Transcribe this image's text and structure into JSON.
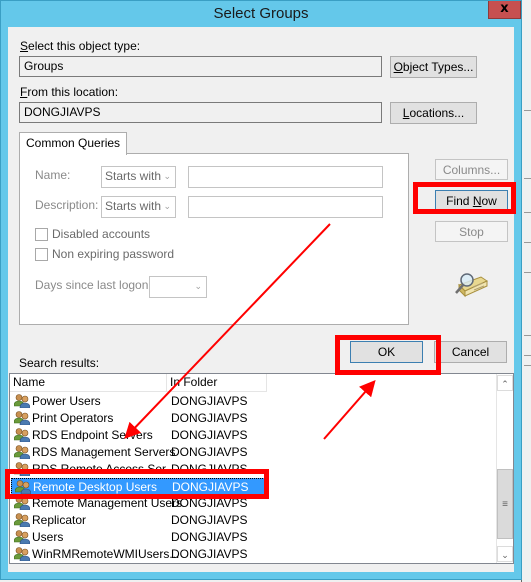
{
  "window": {
    "title": "Select Groups",
    "close_label": "x"
  },
  "object_type": {
    "label_prefix": "S",
    "label_rest": "elect this object type:",
    "value": "Groups",
    "button_prefix": "O",
    "button_rest": "bject Types..."
  },
  "location": {
    "label_prefix": "F",
    "label_rest": "rom this location:",
    "value": "DONGJIAVPS",
    "button_prefix": "L",
    "button_rest": "ocations..."
  },
  "query_tab": {
    "label": "Common Queries",
    "name_label": "Name:",
    "name_operator": "Starts with",
    "name_value": "",
    "description_label": "Description:",
    "description_operator": "Starts with",
    "description_value": "",
    "disabled_accounts_label": "Disabled accounts",
    "disabled_accounts_checked": false,
    "non_expiring_label": "Non expiring password",
    "non_expiring_checked": false,
    "days_label": "Days since last logon:",
    "days_value": ""
  },
  "side_buttons": {
    "columns": "Columns...",
    "find_now_prefix": "Find ",
    "find_now_u": "N",
    "find_now_rest": "ow",
    "stop": "Stop",
    "search_icon": "magnifier-over-directory-icon"
  },
  "dialog_buttons": {
    "ok": "OK",
    "cancel": "Cancel"
  },
  "results": {
    "label": "Search results:",
    "columns": [
      "Name",
      "In Folder"
    ],
    "rows": [
      {
        "name": "Power Users",
        "folder": "DONGJIAVPS",
        "selected": false
      },
      {
        "name": "Print Operators",
        "folder": "DONGJIAVPS",
        "selected": false
      },
      {
        "name": "RDS Endpoint Servers",
        "folder": "DONGJIAVPS",
        "selected": false
      },
      {
        "name": "RDS Management Servers",
        "folder": "DONGJIAVPS",
        "selected": false
      },
      {
        "name": "RDS Remote Access Ser...",
        "folder": "DONGJIAVPS",
        "selected": false
      },
      {
        "name": "Remote Desktop Users",
        "folder": "DONGJIAVPS",
        "selected": true
      },
      {
        "name": "Remote Management Users",
        "folder": "DONGJIAVPS",
        "selected": false
      },
      {
        "name": "Replicator",
        "folder": "DONGJIAVPS",
        "selected": false
      },
      {
        "name": "Users",
        "folder": "DONGJIAVPS",
        "selected": false
      },
      {
        "name": "WinRMRemoteWMIUsers...",
        "folder": "DONGJIAVPS",
        "selected": false
      }
    ],
    "scroll_fraction": 1.0
  },
  "annotations": {
    "color": "#ff0000",
    "highlighted": [
      "Find Now",
      "OK",
      "Remote Desktop Users"
    ]
  },
  "colors": {
    "frame": "#64c8ea",
    "close": "#c75050",
    "selection": "#3399ff",
    "annotation": "#ff0000"
  }
}
